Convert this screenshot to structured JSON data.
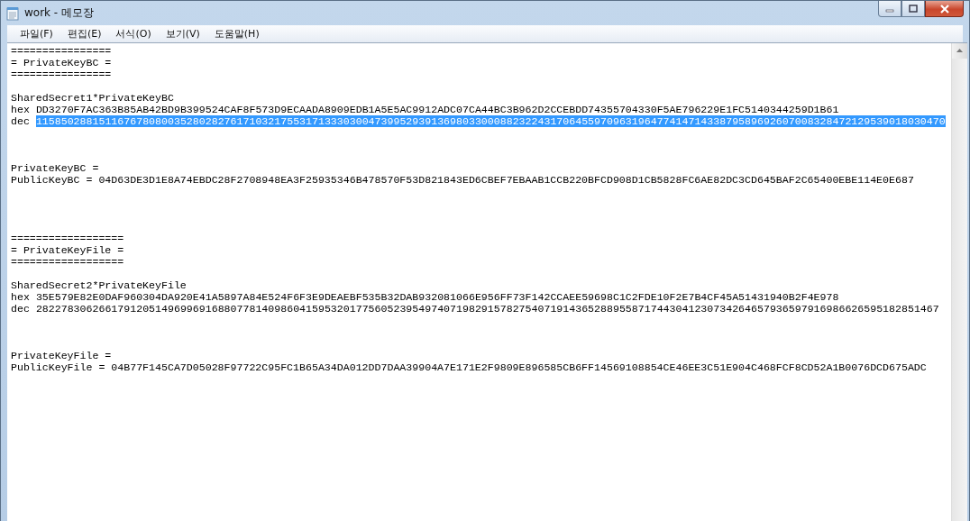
{
  "window": {
    "title": "work - 메모장"
  },
  "menu": [
    {
      "label": "파일(F)"
    },
    {
      "label": "편집(E)"
    },
    {
      "label": "서식(O)"
    },
    {
      "label": "보기(V)"
    },
    {
      "label": "도움말(H)"
    }
  ],
  "lines": [
    {
      "kind": "text",
      "text": "================",
      "selected": false
    },
    {
      "kind": "text",
      "text": "= PrivateKeyBC =",
      "selected": false
    },
    {
      "kind": "text",
      "text": "================",
      "selected": false
    },
    {
      "kind": "blank"
    },
    {
      "kind": "text",
      "text": "SharedSecret1*PrivateKeyBC",
      "selected": false
    },
    {
      "kind": "labeled",
      "label": "hex",
      "text": "DD3270F7AC363B85AB42BD9B399524CAF8F573D9ECAADA8909EDB1A5E5AC9912ADC07CA44BC3B962D2CCEBDD74355704330F5AE796229E1FC5140344259D1B61",
      "selected": false
    },
    {
      "kind": "labeled",
      "label": "dec",
      "text": "1158502881511676780800352802827617103217553171333030047399529391369803300088232243170645597096319647741471433879589692607008328472129539018030470",
      "selected": true
    },
    {
      "kind": "blank"
    },
    {
      "kind": "blank"
    },
    {
      "kind": "blank"
    },
    {
      "kind": "text",
      "text": "PrivateKeyBC =",
      "selected": false
    },
    {
      "kind": "text",
      "text": "PublicKeyBC = 04D63DE3D1E8A74EBDC28F2708948EA3F25935346B478570F53D821843ED6CBEF7EBAAB1CCB220BFCD908D1CB5828FC6AE82DC3CD645BAF2C65400EBE114E0E687",
      "selected": false
    },
    {
      "kind": "blank"
    },
    {
      "kind": "blank"
    },
    {
      "kind": "blank"
    },
    {
      "kind": "blank"
    },
    {
      "kind": "text",
      "text": "==================",
      "selected": false
    },
    {
      "kind": "text",
      "text": "= PrivateKeyFile =",
      "selected": false
    },
    {
      "kind": "text",
      "text": "==================",
      "selected": false
    },
    {
      "kind": "blank"
    },
    {
      "kind": "text",
      "text": "SharedSecret2*PrivateKeyFile",
      "selected": false
    },
    {
      "kind": "labeled",
      "label": "hex",
      "text": "35E579E82E0DAF960304DA920E41A5897A84E524F6F3E9DEAEBF535B32DAB932081066E956FF73F142CCAEE59698C1C2FDE10F2E7B4CF45A51431940B2F4E978",
      "selected": false
    },
    {
      "kind": "labeled",
      "label": "dec",
      "text": "282278306266179120514969969168807781409860415953201775605239549740719829157827540719143652889558717443041230734264657936597916986626595182851467",
      "selected": false
    },
    {
      "kind": "blank"
    },
    {
      "kind": "blank"
    },
    {
      "kind": "blank"
    },
    {
      "kind": "text",
      "text": "PrivateKeyFile =",
      "selected": false
    },
    {
      "kind": "text",
      "text": "PublicKeyFile = 04B77F145CA7D05028F97722C95FC1B65A34DA012DD7DAA39904A7E171E2F9809E896585CB6FF14569108854CE46EE3C51E904C468FCF8CD52A1B0076DCD675ADC",
      "selected": false
    }
  ]
}
